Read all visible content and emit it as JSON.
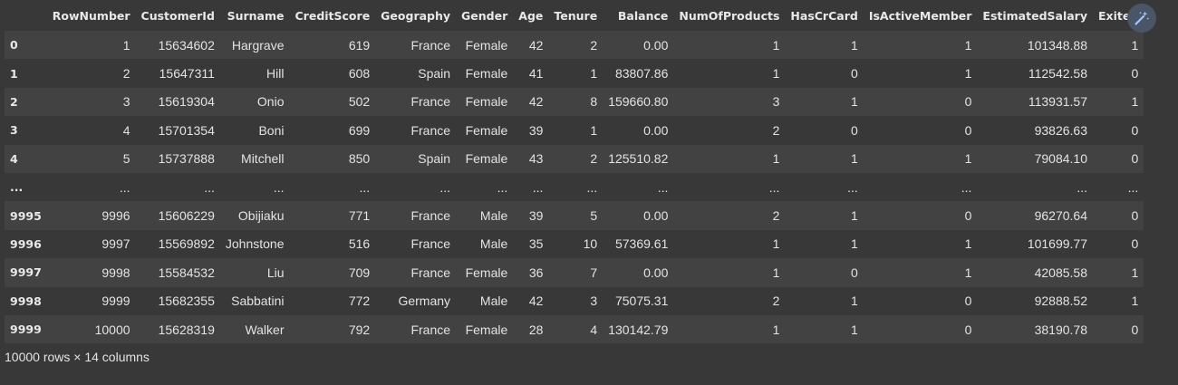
{
  "table": {
    "index_header": "",
    "columns": [
      "RowNumber",
      "CustomerId",
      "Surname",
      "CreditScore",
      "Geography",
      "Gender",
      "Age",
      "Tenure",
      "Balance",
      "NumOfProducts",
      "HasCrCard",
      "IsActiveMember",
      "EstimatedSalary",
      "Exited"
    ],
    "rows": [
      {
        "index": "0",
        "cells": [
          "1",
          "15634602",
          "Hargrave",
          "619",
          "France",
          "Female",
          "42",
          "2",
          "0.00",
          "1",
          "1",
          "1",
          "101348.88",
          "1"
        ]
      },
      {
        "index": "1",
        "cells": [
          "2",
          "15647311",
          "Hill",
          "608",
          "Spain",
          "Female",
          "41",
          "1",
          "83807.86",
          "1",
          "0",
          "1",
          "112542.58",
          "0"
        ]
      },
      {
        "index": "2",
        "cells": [
          "3",
          "15619304",
          "Onio",
          "502",
          "France",
          "Female",
          "42",
          "8",
          "159660.80",
          "3",
          "1",
          "0",
          "113931.57",
          "1"
        ]
      },
      {
        "index": "3",
        "cells": [
          "4",
          "15701354",
          "Boni",
          "699",
          "France",
          "Female",
          "39",
          "1",
          "0.00",
          "2",
          "0",
          "0",
          "93826.63",
          "0"
        ]
      },
      {
        "index": "4",
        "cells": [
          "5",
          "15737888",
          "Mitchell",
          "850",
          "Spain",
          "Female",
          "43",
          "2",
          "125510.82",
          "1",
          "1",
          "1",
          "79084.10",
          "0"
        ]
      },
      {
        "index": "...",
        "cells": [
          "...",
          "...",
          "...",
          "...",
          "...",
          "...",
          "...",
          "...",
          "...",
          "...",
          "...",
          "...",
          "...",
          "..."
        ]
      },
      {
        "index": "9995",
        "cells": [
          "9996",
          "15606229",
          "Obijiaku",
          "771",
          "France",
          "Male",
          "39",
          "5",
          "0.00",
          "2",
          "1",
          "0",
          "96270.64",
          "0"
        ]
      },
      {
        "index": "9996",
        "cells": [
          "9997",
          "15569892",
          "Johnstone",
          "516",
          "France",
          "Male",
          "35",
          "10",
          "57369.61",
          "1",
          "1",
          "1",
          "101699.77",
          "0"
        ]
      },
      {
        "index": "9997",
        "cells": [
          "9998",
          "15584532",
          "Liu",
          "709",
          "France",
          "Female",
          "36",
          "7",
          "0.00",
          "1",
          "0",
          "1",
          "42085.58",
          "1"
        ]
      },
      {
        "index": "9998",
        "cells": [
          "9999",
          "15682355",
          "Sabbatini",
          "772",
          "Germany",
          "Male",
          "42",
          "3",
          "75075.31",
          "2",
          "1",
          "0",
          "92888.52",
          "1"
        ]
      },
      {
        "index": "9999",
        "cells": [
          "10000",
          "15628319",
          "Walker",
          "792",
          "France",
          "Female",
          "28",
          "4",
          "130142.79",
          "1",
          "1",
          "0",
          "38190.78",
          "0"
        ]
      }
    ]
  },
  "summary": "10000 rows × 14 columns",
  "magic_button": {
    "icon": "magic-wand-icon"
  },
  "colors": {
    "background": "#383838",
    "row_alt": "#424242",
    "text": "#e3e3e3",
    "button_bg": "#4a5568",
    "icon": "#a8c7fa"
  }
}
